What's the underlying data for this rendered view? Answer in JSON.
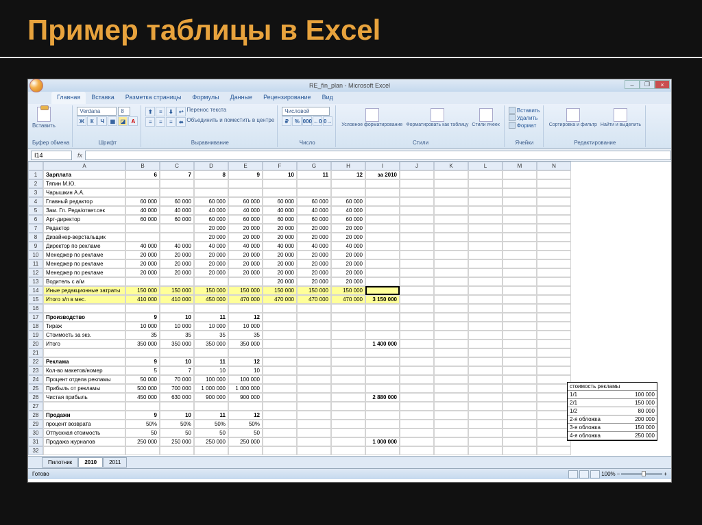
{
  "slide_title": "Пример таблицы в Excel",
  "window_title": "RE_fin_plan - Microsoft Excel",
  "tabs": [
    "Главная",
    "Вставка",
    "Разметка страницы",
    "Формулы",
    "Данные",
    "Рецензирование",
    "Вид"
  ],
  "ribbon": {
    "clipboard": {
      "paste": "Вставить",
      "label": "Буфер обмена"
    },
    "font": {
      "name": "Verdana",
      "size": "8",
      "label": "Шрифт"
    },
    "align": {
      "wrap": "Перенос текста",
      "merge": "Объединить и поместить в центре",
      "label": "Выравнивание"
    },
    "number": {
      "format": "Числовой",
      "label": "Число"
    },
    "styles": {
      "cond": "Условное форматирование",
      "fmt": "Форматировать как таблицу",
      "cell": "Стили ячеек",
      "label": "Стили"
    },
    "cells": {
      "insert": "Вставить",
      "delete": "Удалить",
      "format": "Формат",
      "label": "Ячейки"
    },
    "editing": {
      "sort": "Сортировка и фильтр",
      "find": "Найти и выделить",
      "label": "Редактирование"
    }
  },
  "namebox": "I14",
  "columns": [
    "A",
    "B",
    "C",
    "D",
    "E",
    "F",
    "G",
    "H",
    "I",
    "J",
    "K",
    "L",
    "M",
    "N"
  ],
  "rows": [
    {
      "n": 1,
      "label": "Зарплата",
      "bold": true,
      "vals": [
        "6",
        "7",
        "8",
        "9",
        "10",
        "11",
        "12",
        "за 2010"
      ]
    },
    {
      "n": 2,
      "label": "Тяпин М.Ю.",
      "vals": [
        "",
        "",
        "",
        "",
        "",
        "",
        "",
        ""
      ]
    },
    {
      "n": 3,
      "label": "Чарышкин А.А.",
      "vals": [
        "",
        "",
        "",
        "",
        "",
        "",
        "",
        ""
      ]
    },
    {
      "n": 4,
      "label": "Главный редактор",
      "vals": [
        "60 000",
        "60 000",
        "60 000",
        "60 000",
        "60 000",
        "60 000",
        "60 000",
        ""
      ]
    },
    {
      "n": 5,
      "label": "Зам. Гл. Реда/ответ.сек",
      "vals": [
        "40 000",
        "40 000",
        "40 000",
        "40 000",
        "40 000",
        "40 000",
        "40 000",
        ""
      ]
    },
    {
      "n": 6,
      "label": "Арт-директор",
      "vals": [
        "60 000",
        "60 000",
        "60 000",
        "60 000",
        "60 000",
        "60 000",
        "60 000",
        ""
      ]
    },
    {
      "n": 7,
      "label": "Редактор",
      "vals": [
        "",
        "",
        "20 000",
        "20 000",
        "20 000",
        "20 000",
        "20 000",
        ""
      ]
    },
    {
      "n": 8,
      "label": "Дизайнер-верстальщик",
      "vals": [
        "",
        "",
        "20 000",
        "20 000",
        "20 000",
        "20 000",
        "20 000",
        ""
      ]
    },
    {
      "n": 9,
      "label": "Директор по рекламе",
      "vals": [
        "40 000",
        "40 000",
        "40 000",
        "40 000",
        "40 000",
        "40 000",
        "40 000",
        ""
      ]
    },
    {
      "n": 10,
      "label": "Менеджер по рекламе",
      "vals": [
        "20 000",
        "20 000",
        "20 000",
        "20 000",
        "20 000",
        "20 000",
        "20 000",
        ""
      ]
    },
    {
      "n": 11,
      "label": "Менеджер по рекламе",
      "vals": [
        "20 000",
        "20 000",
        "20 000",
        "20 000",
        "20 000",
        "20 000",
        "20 000",
        ""
      ]
    },
    {
      "n": 12,
      "label": "Менеджер по рекламе",
      "vals": [
        "20 000",
        "20 000",
        "20 000",
        "20 000",
        "20 000",
        "20 000",
        "20 000",
        ""
      ]
    },
    {
      "n": 13,
      "label": "Водитель с а/м",
      "vals": [
        "",
        "",
        "",
        "",
        "20 000",
        "20 000",
        "20 000",
        ""
      ]
    },
    {
      "n": 14,
      "label": "Иные редакционные затраты",
      "yel": true,
      "vals": [
        "150 000",
        "150 000",
        "150 000",
        "150 000",
        "150 000",
        "150 000",
        "150 000",
        ""
      ],
      "sel": true
    },
    {
      "n": 15,
      "label": "Итого з/п в мес.",
      "yel": true,
      "vals": [
        "410 000",
        "410 000",
        "450 000",
        "470 000",
        "470 000",
        "470 000",
        "470 000",
        "3 150 000"
      ],
      "boldI": true
    },
    {
      "n": 16,
      "label": "",
      "vals": [
        "",
        "",
        "",
        "",
        "",
        "",
        "",
        ""
      ]
    },
    {
      "n": 17,
      "label": "Производство",
      "bold": true,
      "vals": [
        "9",
        "10",
        "11",
        "12",
        "",
        "",
        "",
        ""
      ]
    },
    {
      "n": 18,
      "label": "Тираж",
      "vals": [
        "10 000",
        "10 000",
        "10 000",
        "10 000",
        "",
        "",
        "",
        ""
      ]
    },
    {
      "n": 19,
      "label": "Стоимость за экз.",
      "vals": [
        "35",
        "35",
        "35",
        "35",
        "",
        "",
        "",
        ""
      ]
    },
    {
      "n": 20,
      "label": "Итого",
      "vals": [
        "350 000",
        "350 000",
        "350 000",
        "350 000",
        "",
        "",
        "",
        "1 400 000"
      ],
      "boldI": true
    },
    {
      "n": 21,
      "label": "",
      "vals": [
        "",
        "",
        "",
        "",
        "",
        "",
        "",
        ""
      ]
    },
    {
      "n": 22,
      "label": "Реклама",
      "bold": true,
      "vals": [
        "9",
        "10",
        "11",
        "12",
        "",
        "",
        "",
        ""
      ]
    },
    {
      "n": 23,
      "label": "Кол-во макетов/номер",
      "vals": [
        "5",
        "7",
        "10",
        "10",
        "",
        "",
        "",
        ""
      ]
    },
    {
      "n": 24,
      "label": "Процент отдела рекламы",
      "vals": [
        "50 000",
        "70 000",
        "100 000",
        "100 000",
        "",
        "",
        "",
        ""
      ]
    },
    {
      "n": 25,
      "label": "Прибыль от рекламы",
      "vals": [
        "500 000",
        "700 000",
        "1 000 000",
        "1 000 000",
        "",
        "",
        "",
        ""
      ]
    },
    {
      "n": 26,
      "label": "Чистая прибыль",
      "vals": [
        "450 000",
        "630 000",
        "900 000",
        "900 000",
        "",
        "",
        "",
        "2 880 000"
      ],
      "boldI": true
    },
    {
      "n": 27,
      "label": "",
      "vals": [
        "",
        "",
        "",
        "",
        "",
        "",
        "",
        ""
      ]
    },
    {
      "n": 28,
      "label": "Продажи",
      "bold": true,
      "vals": [
        "9",
        "10",
        "11",
        "12",
        "",
        "",
        "",
        ""
      ]
    },
    {
      "n": 29,
      "label": "процент возврата",
      "vals": [
        "50%",
        "50%",
        "50%",
        "50%",
        "",
        "",
        "",
        ""
      ]
    },
    {
      "n": 30,
      "label": "Отпускная стоимость",
      "vals": [
        "50",
        "50",
        "50",
        "50",
        "",
        "",
        "",
        ""
      ]
    },
    {
      "n": 31,
      "label": "Продажа журналов",
      "vals": [
        "250 000",
        "250 000",
        "250 000",
        "250 000",
        "",
        "",
        "",
        "1 000 000"
      ],
      "boldI": true
    },
    {
      "n": 32,
      "label": "",
      "vals": [
        "",
        "",
        "",
        "",
        "",
        "",
        "",
        ""
      ]
    }
  ],
  "sidebox": {
    "title": "стоимость рекламы",
    "rows": [
      [
        "1/1",
        "100 000"
      ],
      [
        "2/1",
        "150 000"
      ],
      [
        "1/2",
        "80 000"
      ],
      [
        "2-я обложка",
        "200 000"
      ],
      [
        "3-я обложка",
        "150 000"
      ],
      [
        "4-я обложка",
        "250 000"
      ]
    ]
  },
  "sheet_tabs": [
    "Пилотник",
    "2010",
    "2011"
  ],
  "active_sheet": "2010",
  "status_left": "Готово",
  "zoom": "100%"
}
